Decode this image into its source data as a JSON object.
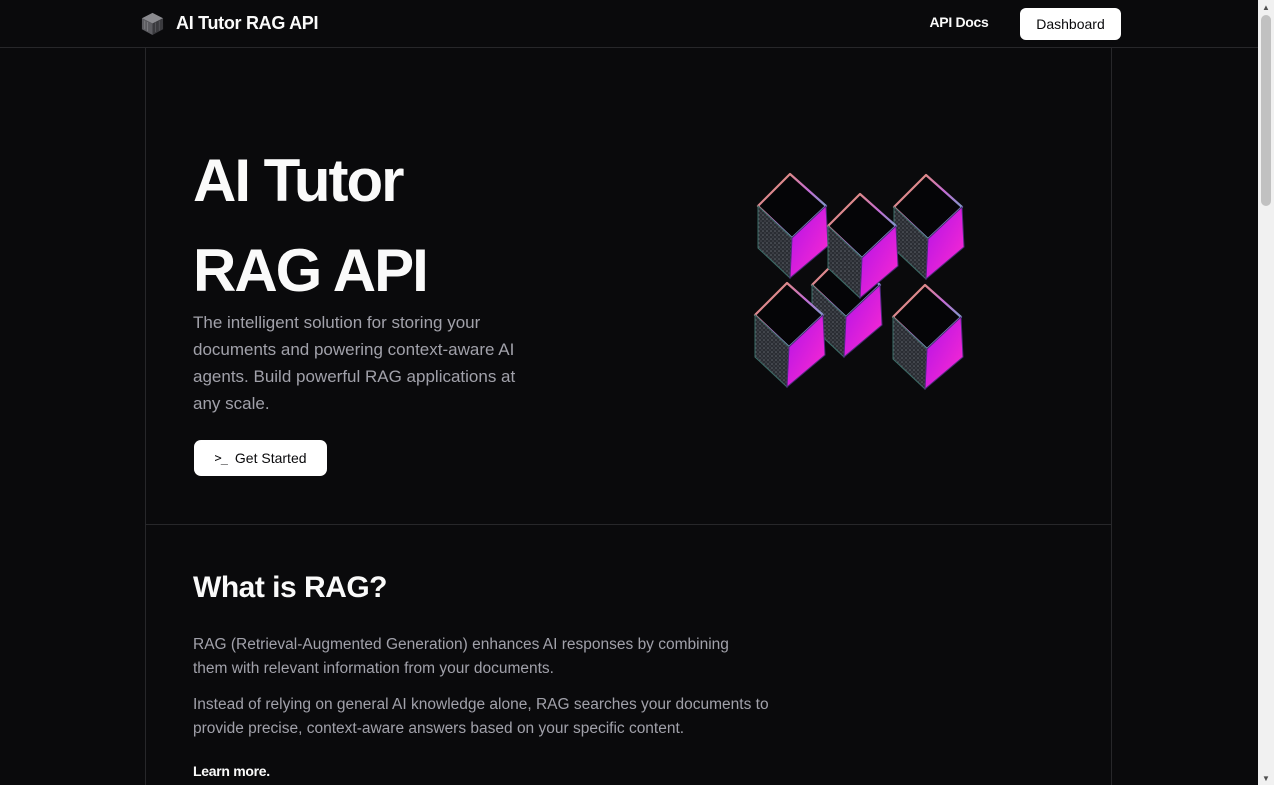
{
  "nav": {
    "brand": "AI Tutor RAG API",
    "api_docs": "API Docs",
    "dashboard": "Dashboard"
  },
  "hero": {
    "title_line1": "AI Tutor",
    "title_line2": "RAG API",
    "description": "The intelligent solution for storing your documents and powering context-aware AI agents. Build powerful RAG applications at any scale.",
    "cta_icon": ">_",
    "cta_label": "Get Started"
  },
  "section": {
    "title": "What is RAG?",
    "paragraph1": "RAG (Retrieval-Augmented Generation) enhances AI responses by combining them with relevant information from your documents.",
    "paragraph2": "Instead of relying on general AI knowledge alone, RAG searches your documents to provide precise, context-aware answers based on your specific content.",
    "learn_more": "Learn more."
  },
  "icons": {
    "logo": "cube-logo-icon",
    "cta": "terminal-icon",
    "art": "cubes-illustration",
    "scroll_up": "scroll-up-arrow-icon",
    "scroll_down": "scroll-down-arrow-icon"
  },
  "colors": {
    "background": "#0a0a0c",
    "border": "#27272a",
    "text": "#fafafa",
    "muted": "#a1a1aa",
    "accent_magenta": "#d81bf0",
    "accent_orange": "#f5a44a"
  }
}
